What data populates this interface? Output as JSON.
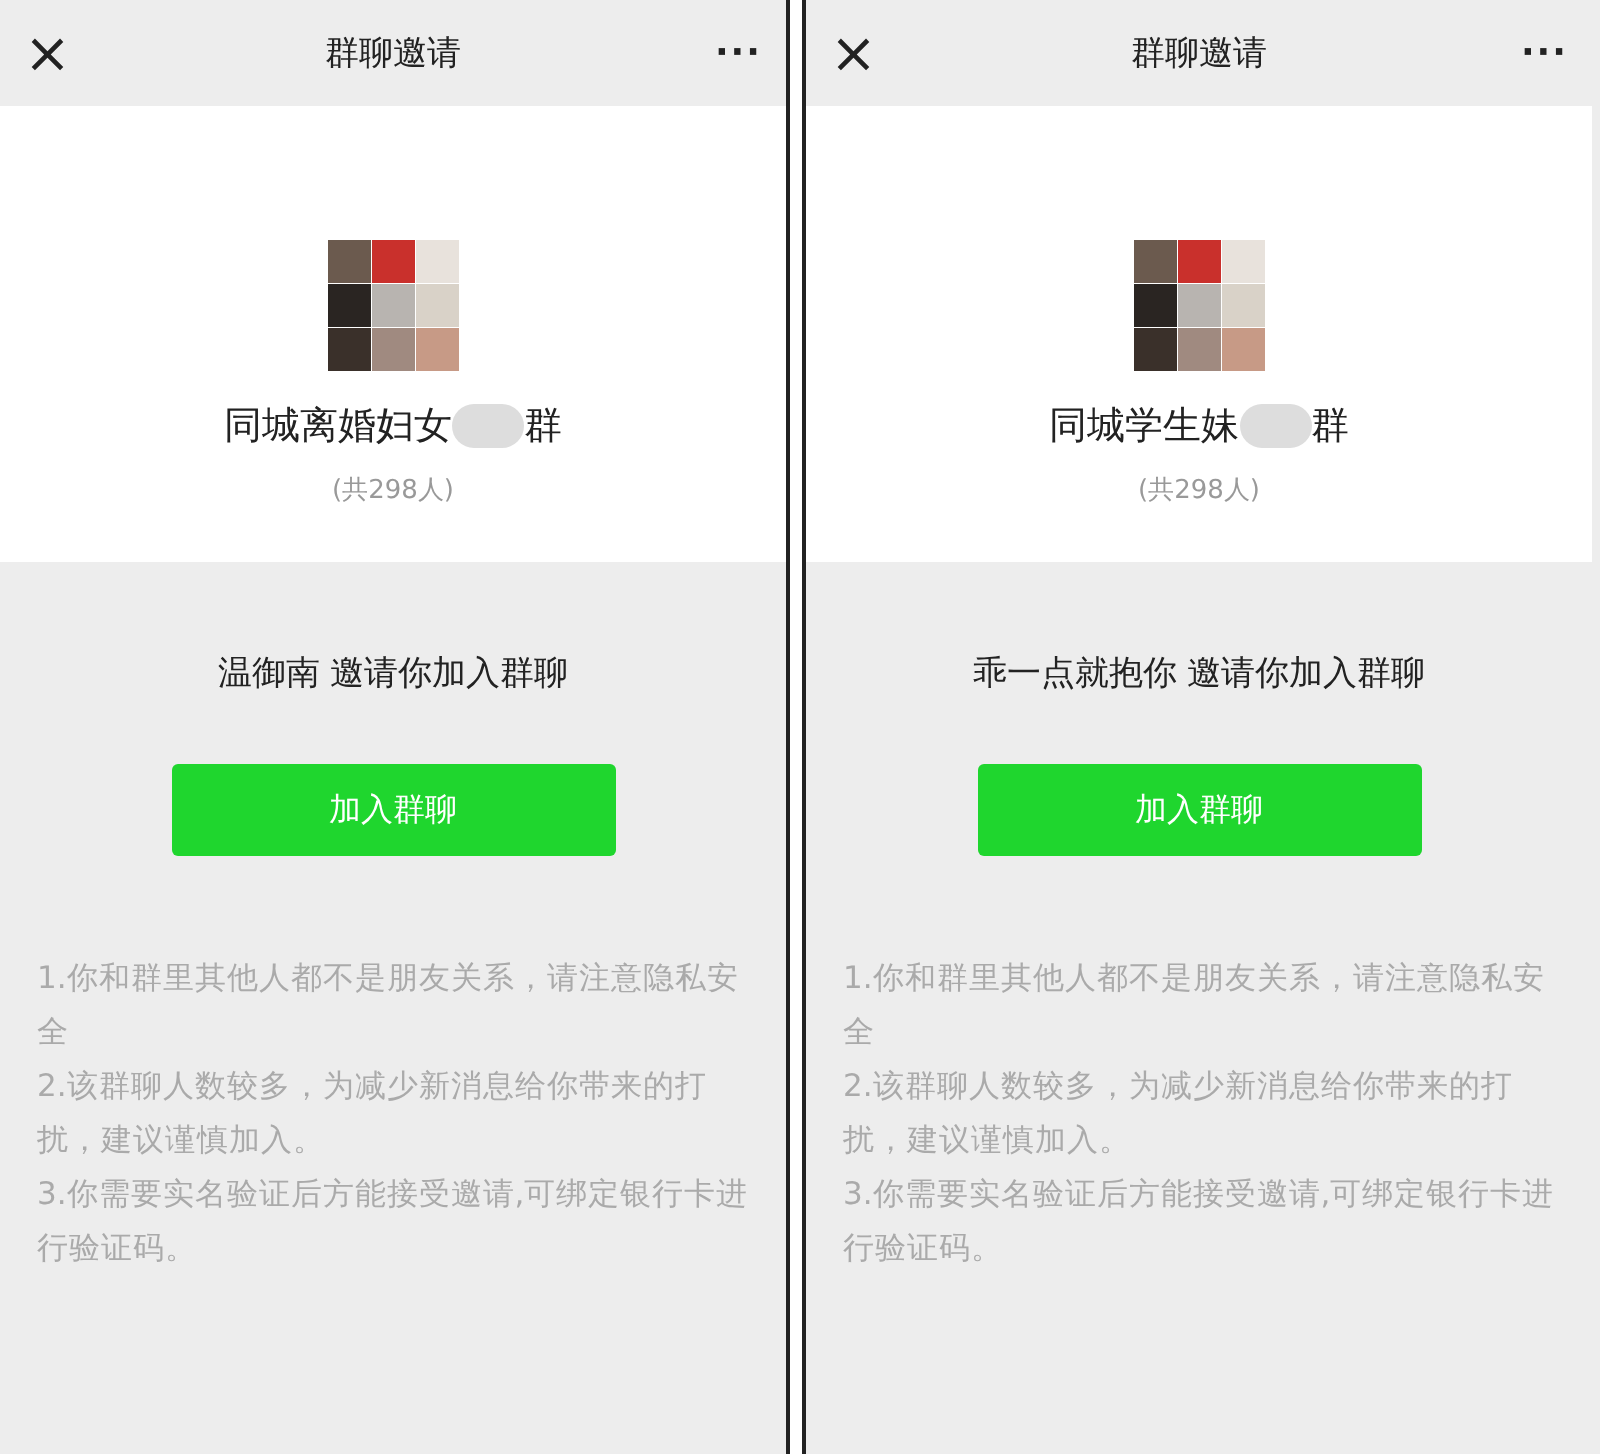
{
  "screens": [
    {
      "header": {
        "close": "×",
        "title": "群聊邀请",
        "more": "···"
      },
      "group": {
        "name_start": "同城离婚妇女",
        "name_end": "群",
        "count": "(共298人)"
      },
      "inviter": "温御南 邀请你加入群聊",
      "join_button": "加入群聊",
      "notes": [
        "1.你和群里其他人都不是朋友关系，请注意隐私安全",
        "2.该群聊人数较多，为减少新消息给你带来的打扰，建议谨慎加入。",
        "3.你需要实名验证后方能接受邀请,可绑定银行卡进行验证码。"
      ]
    },
    {
      "header": {
        "close": "×",
        "title": "群聊邀请",
        "more": "···"
      },
      "group": {
        "name_start": "同城学生妹",
        "name_end": "群",
        "count": "(共298人)"
      },
      "inviter": "乖一点就抱你 邀请你加入群聊",
      "join_button": "加入群聊",
      "notes": [
        "1.你和群里其他人都不是朋友关系，请注意隐私安全",
        "2.该群聊人数较多，为减少新消息给你带来的打扰，建议谨慎加入。",
        "3.你需要实名验证后方能接受邀请,可绑定银行卡进行验证码。"
      ]
    }
  ]
}
